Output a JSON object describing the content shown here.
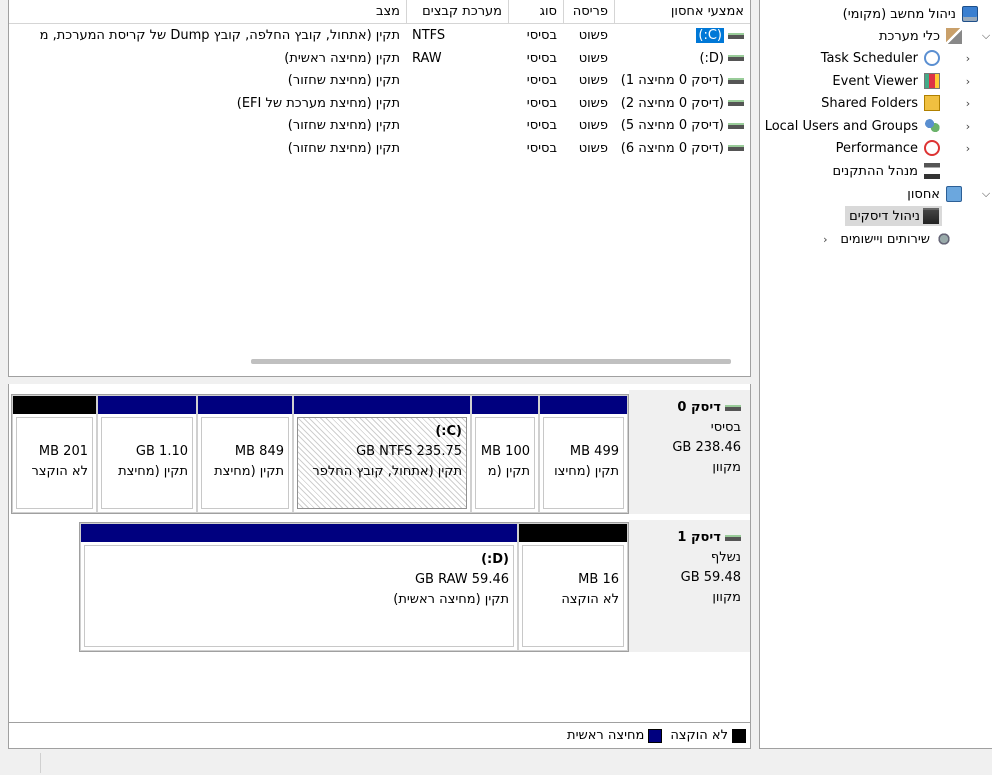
{
  "colors": {
    "primary_partition": "#00007f",
    "unallocated": "#000000",
    "selection": "#d9d9d9"
  },
  "tree": {
    "root": "ניהול מחשב (מקומי)",
    "system_tools": "כלי מערכת",
    "task_scheduler": "Task Scheduler",
    "event_viewer": "Event Viewer",
    "shared_folders": "Shared Folders",
    "local_users": "Local Users and Groups",
    "performance": "Performance",
    "device_manager": "מנהל ההתקנים",
    "storage": "אחסון",
    "disk_management": "ניהול דיסקים",
    "services": "שירותים ויישומים"
  },
  "volumes": {
    "columns": [
      "אמצעי אחסון",
      "פריסה",
      "סוג",
      "מערכת קבצים",
      "מצב"
    ],
    "rows": [
      {
        "name": "(C:)",
        "layout": "פשוט",
        "type": "בסיסי",
        "fs": "NTFS",
        "status": "תקין (אתחול, קובץ החלפה, קובץ Dump של קריסת המערכת, מ"
      },
      {
        "name": "(D:)",
        "layout": "פשוט",
        "type": "בסיסי",
        "fs": "RAW",
        "status": "תקין (מחיצה ראשית)"
      },
      {
        "name": "(דיסק 0 מחיצה 1)",
        "layout": "פשוט",
        "type": "בסיסי",
        "fs": "",
        "status": "תקין (מחיצת שחזור)"
      },
      {
        "name": "(דיסק 0 מחיצה 2)",
        "layout": "פשוט",
        "type": "בסיסי",
        "fs": "",
        "status": "תקין (מחיצת מערכת של EFI)"
      },
      {
        "name": "(דיסק 0 מחיצה 5)",
        "layout": "פשוט",
        "type": "בסיסי",
        "fs": "",
        "status": "תקין (מחיצת שחזור)"
      },
      {
        "name": "(דיסק 0 מחיצה 6)",
        "layout": "פשוט",
        "type": "בסיסי",
        "fs": "",
        "status": "תקין (מחיצת שחזור)"
      }
    ]
  },
  "disks": [
    {
      "name": "דיסק 0",
      "type": "בסיסי",
      "size": "238.46 GB",
      "state": "מקוון",
      "partitions": [
        {
          "title": "",
          "size": "499 MB",
          "status": "תקין (מחיצו",
          "kind": "primary"
        },
        {
          "title": "",
          "size": "100 MB",
          "status": "תקין (מ",
          "kind": "primary"
        },
        {
          "title": "(C:)",
          "size": "235.75 GB NTFS",
          "status": "תקין (אתחול, קובץ החלפר",
          "kind": "primary"
        },
        {
          "title": "",
          "size": "849 MB",
          "status": "תקין (מחיצת",
          "kind": "primary"
        },
        {
          "title": "",
          "size": "1.10 GB",
          "status": "תקין (מחיצת",
          "kind": "primary"
        },
        {
          "title": "",
          "size": "201 MB",
          "status": "לא הוקצר",
          "kind": "unallocated"
        }
      ]
    },
    {
      "name": "דיסק 1",
      "type": "נשלף",
      "size": "59.48 GB",
      "state": "מקוון",
      "partitions": [
        {
          "title": "",
          "size": "16 MB",
          "status": "לא הוקצה",
          "kind": "unallocated"
        },
        {
          "title": "(D:)",
          "size": "59.46 GB RAW",
          "status": "תקין (מחיצה ראשית)",
          "kind": "primary"
        }
      ]
    }
  ],
  "legend": {
    "unallocated": "לא הוקצה",
    "primary": "מחיצה ראשית"
  }
}
